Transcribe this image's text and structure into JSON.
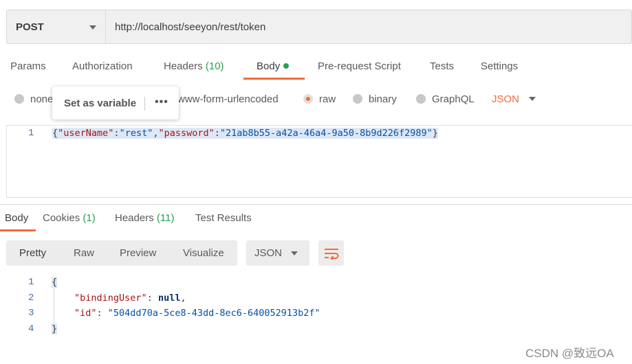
{
  "request": {
    "method": "POST",
    "url": "http://localhost/seeyon/rest/token"
  },
  "tabs": {
    "params": "Params",
    "authorization": "Authorization",
    "headers": "Headers",
    "headers_count": "(10)",
    "body": "Body",
    "prerequest": "Pre-request Script",
    "tests": "Tests",
    "settings": "Settings"
  },
  "body_types": {
    "none": "none",
    "urlencoded": "www-form-urlencoded",
    "raw": "raw",
    "binary": "binary",
    "graphql": "GraphQL",
    "format": "JSON",
    "selected": "raw"
  },
  "popup": {
    "label": "Set as variable",
    "more": "•••"
  },
  "request_body": {
    "line_numbers": [
      "1"
    ],
    "open_brace": "{",
    "key1": "\"userName\"",
    "colon": ":",
    "val1": "\"rest\"",
    "comma": ",",
    "key2": "\"password\"",
    "val2": "\"21ab8b55-a42a-46a4-9a50-8b9d226f2989\"",
    "close_brace": "}"
  },
  "response_tabs": {
    "body": "Body",
    "cookies": "Cookies",
    "cookies_count": "(1)",
    "headers": "Headers",
    "headers_count": "(11)",
    "test_results": "Test Results"
  },
  "view": {
    "pretty": "Pretty",
    "raw": "Raw",
    "preview": "Preview",
    "visualize": "Visualize",
    "format": "JSON"
  },
  "response_body": {
    "line_numbers": [
      "1",
      "2",
      "3",
      "4"
    ],
    "open_brace": "{",
    "key1": "\"bindingUser\"",
    "colon": ":",
    "val1": "null",
    "comma": ",",
    "key2": "\"id\"",
    "val2": "\"504dd70a-5ce8-43dd-8ec6-640052913b2f\"",
    "close_brace": "}"
  },
  "watermark": "CSDN @致远OA",
  "colors": {
    "accent": "#f26b3a",
    "count_green": "#26a151",
    "json_key": "#a31515",
    "json_string": "#0451a5"
  }
}
